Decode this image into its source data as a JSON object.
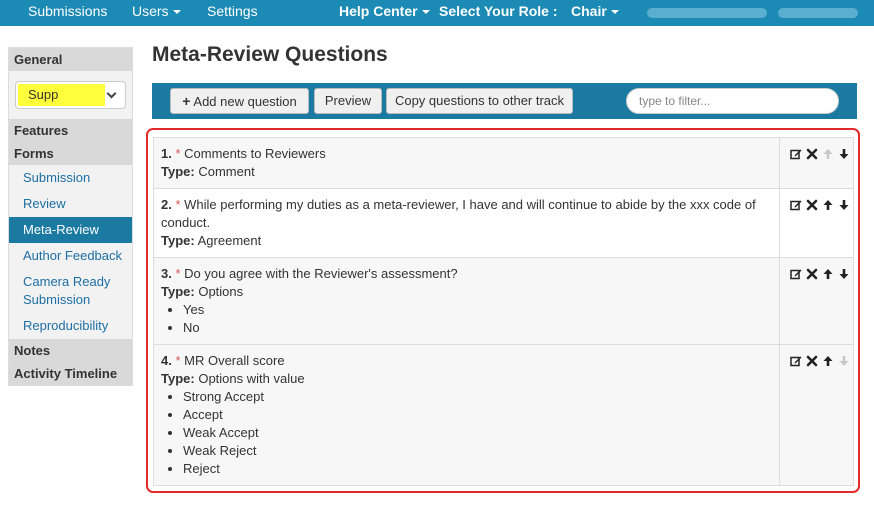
{
  "nav": {
    "submissions": "Submissions",
    "users": "Users",
    "settings": "Settings",
    "help_center": "Help Center",
    "select_role": "Select Your Role :",
    "role": "Chair"
  },
  "sidebar": {
    "general": "General",
    "track_select": "Supp",
    "features": "Features",
    "forms": "Forms",
    "items": [
      "Submission",
      "Review",
      "Meta-Review",
      "Author Feedback",
      "Camera Ready Submission",
      "Reproducibility"
    ],
    "active_index": 2,
    "notes": "Notes",
    "activity": "Activity Timeline"
  },
  "page": {
    "title": "Meta-Review Questions"
  },
  "toolbar": {
    "add_label": "Add new question",
    "preview_label": "Preview",
    "copy_label": "Copy questions to other track",
    "filter_placeholder": "type to filter..."
  },
  "type_label": "Type:",
  "questions": [
    {
      "num": "1.",
      "text": "Comments to Reviewers",
      "type": "Comment",
      "options": [],
      "up_disabled": true,
      "down_disabled": false
    },
    {
      "num": "2.",
      "text": "While performing my duties as a meta-reviewer, I have and will continue to abide by the xxx code of conduct.",
      "type": "Agreement",
      "options": [],
      "up_disabled": false,
      "down_disabled": false
    },
    {
      "num": "3.",
      "text": "Do you agree with the Reviewer's assessment?",
      "type": "Options",
      "options": [
        "Yes",
        "No"
      ],
      "up_disabled": false,
      "down_disabled": false
    },
    {
      "num": "4.",
      "text": "MR Overall score",
      "type": "Options with value",
      "options": [
        "Strong Accept",
        "Accept",
        "Weak Accept",
        "Weak Reject",
        "Reject"
      ],
      "up_disabled": false,
      "down_disabled": true
    }
  ],
  "colors": {
    "nav_bg": "#1b8ab5",
    "toolbar_bg": "#1b7aa2",
    "highlight": "#ffff3c",
    "required": "#d9534f",
    "outline": "#e32a2a"
  }
}
